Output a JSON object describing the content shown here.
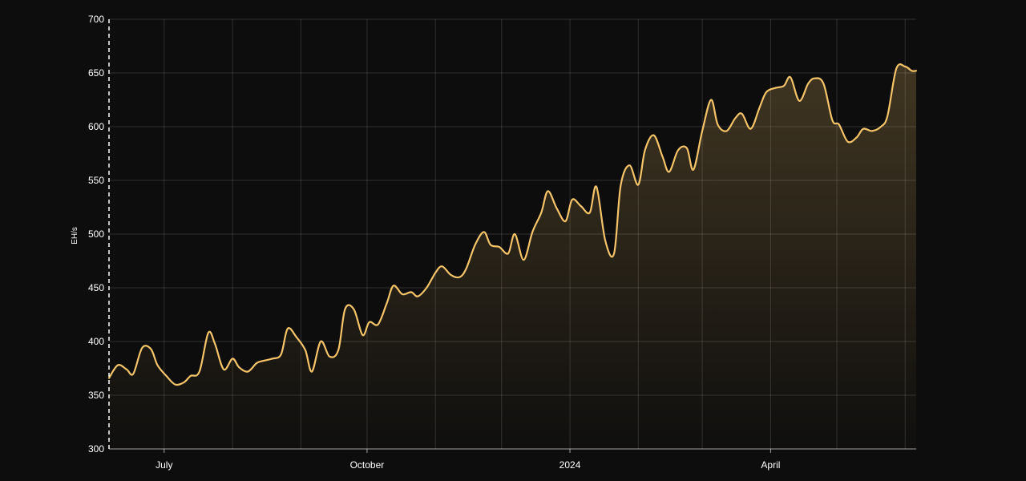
{
  "chart_data": {
    "type": "area",
    "title": "",
    "xlabel": "",
    "ylabel": "EH/s",
    "ylim": [
      300,
      700
    ],
    "yticks": [
      300,
      350,
      400,
      450,
      500,
      550,
      600,
      650,
      700
    ],
    "xrange": [
      "2023-06-06",
      "2024-06-06"
    ],
    "xticks": [
      {
        "date": "2023-07-01",
        "label": "July"
      },
      {
        "date": "2023-10-01",
        "label": "October"
      },
      {
        "date": "2024-01-01",
        "label": "2024"
      },
      {
        "date": "2024-04-01",
        "label": "April"
      }
    ],
    "grid": true,
    "series": [
      {
        "color": "#f5c469",
        "x": [
          "2023-06-06",
          "2023-06-10",
          "2023-06-14",
          "2023-06-17",
          "2023-06-21",
          "2023-06-25",
          "2023-06-28",
          "2023-07-02",
          "2023-07-06",
          "2023-07-10",
          "2023-07-13",
          "2023-07-17",
          "2023-07-21",
          "2023-07-24",
          "2023-07-28",
          "2023-08-01",
          "2023-08-04",
          "2023-08-08",
          "2023-08-12",
          "2023-08-15",
          "2023-08-19",
          "2023-08-23",
          "2023-08-26",
          "2023-08-30",
          "2023-09-03",
          "2023-09-06",
          "2023-09-10",
          "2023-09-14",
          "2023-09-18",
          "2023-09-21",
          "2023-09-25",
          "2023-09-29",
          "2023-10-02",
          "2023-10-06",
          "2023-10-10",
          "2023-10-13",
          "2023-10-17",
          "2023-10-21",
          "2023-10-24",
          "2023-10-28",
          "2023-11-01",
          "2023-11-04",
          "2023-11-08",
          "2023-11-12",
          "2023-11-15",
          "2023-11-19",
          "2023-11-23",
          "2023-11-26",
          "2023-11-30",
          "2023-12-04",
          "2023-12-07",
          "2023-12-11",
          "2023-12-15",
          "2023-12-19",
          "2023-12-22",
          "2023-12-26",
          "2023-12-30",
          "2024-01-02",
          "2024-01-06",
          "2024-01-10",
          "2024-01-13",
          "2024-01-17",
          "2024-01-21",
          "2024-01-24",
          "2024-01-28",
          "2024-02-01",
          "2024-02-04",
          "2024-02-08",
          "2024-02-12",
          "2024-02-15",
          "2024-02-19",
          "2024-02-23",
          "2024-02-26",
          "2024-03-01",
          "2024-03-05",
          "2024-03-08",
          "2024-03-12",
          "2024-03-16",
          "2024-03-19",
          "2024-03-23",
          "2024-03-27",
          "2024-03-30",
          "2024-04-03",
          "2024-04-07",
          "2024-04-10",
          "2024-04-14",
          "2024-04-18",
          "2024-04-21",
          "2024-04-25",
          "2024-04-29",
          "2024-05-02",
          "2024-05-06",
          "2024-05-10",
          "2024-05-13",
          "2024-05-17",
          "2024-05-21",
          "2024-05-24",
          "2024-05-28",
          "2024-06-01",
          "2024-06-04",
          "2024-06-06"
        ],
        "values": [
          366,
          378,
          374,
          370,
          394,
          393,
          378,
          368,
          360,
          362,
          368,
          372,
          408,
          398,
          374,
          384,
          376,
          372,
          380,
          382,
          384,
          388,
          412,
          404,
          392,
          372,
          400,
          386,
          392,
          430,
          430,
          406,
          418,
          416,
          436,
          452,
          444,
          446,
          442,
          450,
          464,
          470,
          462,
          460,
          468,
          490,
          502,
          490,
          488,
          482,
          500,
          476,
          502,
          520,
          540,
          524,
          512,
          532,
          526,
          520,
          544,
          494,
          482,
          545,
          564,
          546,
          578,
          592,
          572,
          558,
          578,
          580,
          560,
          596,
          625,
          602,
          596,
          608,
          612,
          598,
          618,
          632,
          636,
          638,
          646,
          624,
          640,
          645,
          640,
          606,
          602,
          586,
          590,
          598,
          596,
          600,
          610,
          654,
          656,
          652,
          652
        ]
      }
    ]
  }
}
